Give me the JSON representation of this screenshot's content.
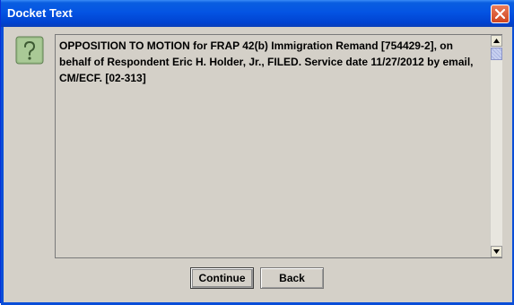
{
  "window": {
    "title": "Docket Text"
  },
  "icons": {
    "help": "question-mark-icon",
    "close": "close-icon",
    "scroll_up": "arrow-up-icon",
    "scroll_down": "arrow-down-icon"
  },
  "docket": {
    "text": "OPPOSITION TO MOTION for FRAP 42(b) Immigration Remand [754429-2], on behalf of Respondent Eric H. Holder, Jr., FILED. Service date 11/27/2012 by email, CM/ECF. [02-313]"
  },
  "buttons": {
    "continue_label": "Continue",
    "back_label": "Back"
  },
  "colors": {
    "titlebar": "#0454e3",
    "client_bg": "#d4d0c8",
    "close_button": "#d0451f"
  }
}
